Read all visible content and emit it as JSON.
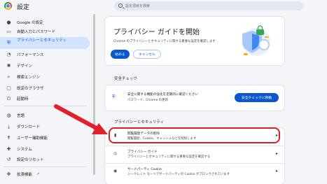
{
  "header": {
    "title": "設定",
    "search_placeholder": "設定項目を検索"
  },
  "sidebar": {
    "items": [
      {
        "label": "Google の設定",
        "icon": "person-icon"
      },
      {
        "label": "自動入力とパスワード",
        "icon": "autofill-icon"
      },
      {
        "label": "プライバシーとセキュリティ",
        "icon": "shield-icon"
      },
      {
        "label": "パフォーマンス",
        "icon": "speed-icon"
      },
      {
        "label": "デザイン",
        "icon": "palette-icon"
      },
      {
        "label": "検索エンジン",
        "icon": "search-icon"
      },
      {
        "label": "既定のブラウザ",
        "icon": "browser-icon"
      },
      {
        "label": "起動時",
        "icon": "power-icon"
      },
      {
        "label": "言語",
        "icon": "globe-icon"
      },
      {
        "label": "ダウンロード",
        "icon": "download-icon"
      },
      {
        "label": "ユーザー補助機能",
        "icon": "accessibility-icon"
      },
      {
        "label": "システム",
        "icon": "wrench-icon"
      },
      {
        "label": "設定のリセット",
        "icon": "reset-icon"
      },
      {
        "label": "拡張機能",
        "icon": "puzzle-icon"
      }
    ]
  },
  "hero": {
    "title": "プライバシー ガイドを開始",
    "desc": "Chrome のプライバシーとセキュリティに関する重要な設定を確認します",
    "start_button": "始める",
    "cancel_button": "キャンセル"
  },
  "safety_check": {
    "section_title": "安全チェック",
    "line1": "安全に関する機能の強化を定期的に確認ください",
    "line2": "パスワード、Chrome の更新",
    "button": "安全チェックに移動"
  },
  "privacy": {
    "section_title": "プライバシーとセキュリティ",
    "rows": [
      {
        "title": "閲覧履歴データの削除",
        "desc": "閲覧履歴、Cookie、キャッシュなどを削除します"
      },
      {
        "title": "プライバシー ガイド",
        "desc": "プライバシーとセキュリティに関する重要な設定を確認する"
      },
      {
        "title": "サードパーティ Cookie",
        "desc": "シークレット モードでサードパーティの Cookie がブロックされています"
      }
    ]
  },
  "colors": {
    "accent": "#0b57d0",
    "highlight": "#d9202a",
    "arrow": "#e0212b"
  }
}
